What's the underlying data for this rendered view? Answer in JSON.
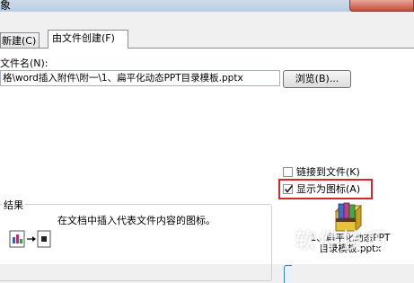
{
  "window": {
    "title": "象"
  },
  "tabs": [
    {
      "label": "新建(C)",
      "active": false
    },
    {
      "label": "由文件创建(F)",
      "active": true
    }
  ],
  "file_name": {
    "label": "文件名(N):",
    "value": "格\\word插入附件\\附一\\1、扁平化动态PPT目录模板.pptx"
  },
  "browse_button": {
    "label": "浏览(B)..."
  },
  "checkboxes": {
    "link_to_file": {
      "label": "链接到文件(K)",
      "checked": false
    },
    "display_as_icon": {
      "label": "显示为图标(A)",
      "checked": true
    }
  },
  "result": {
    "label": "结果",
    "description": "在文档中插入代表文件内容的图标。"
  },
  "file_icon": {
    "icon": "winrar-archive-icon",
    "caption_line1": "1、扁平化动态PPT",
    "caption_line2": "目录模板.pptx"
  },
  "watermark": {
    "text": "软件技巧"
  },
  "colors": {
    "highlight": "#d8262a"
  }
}
